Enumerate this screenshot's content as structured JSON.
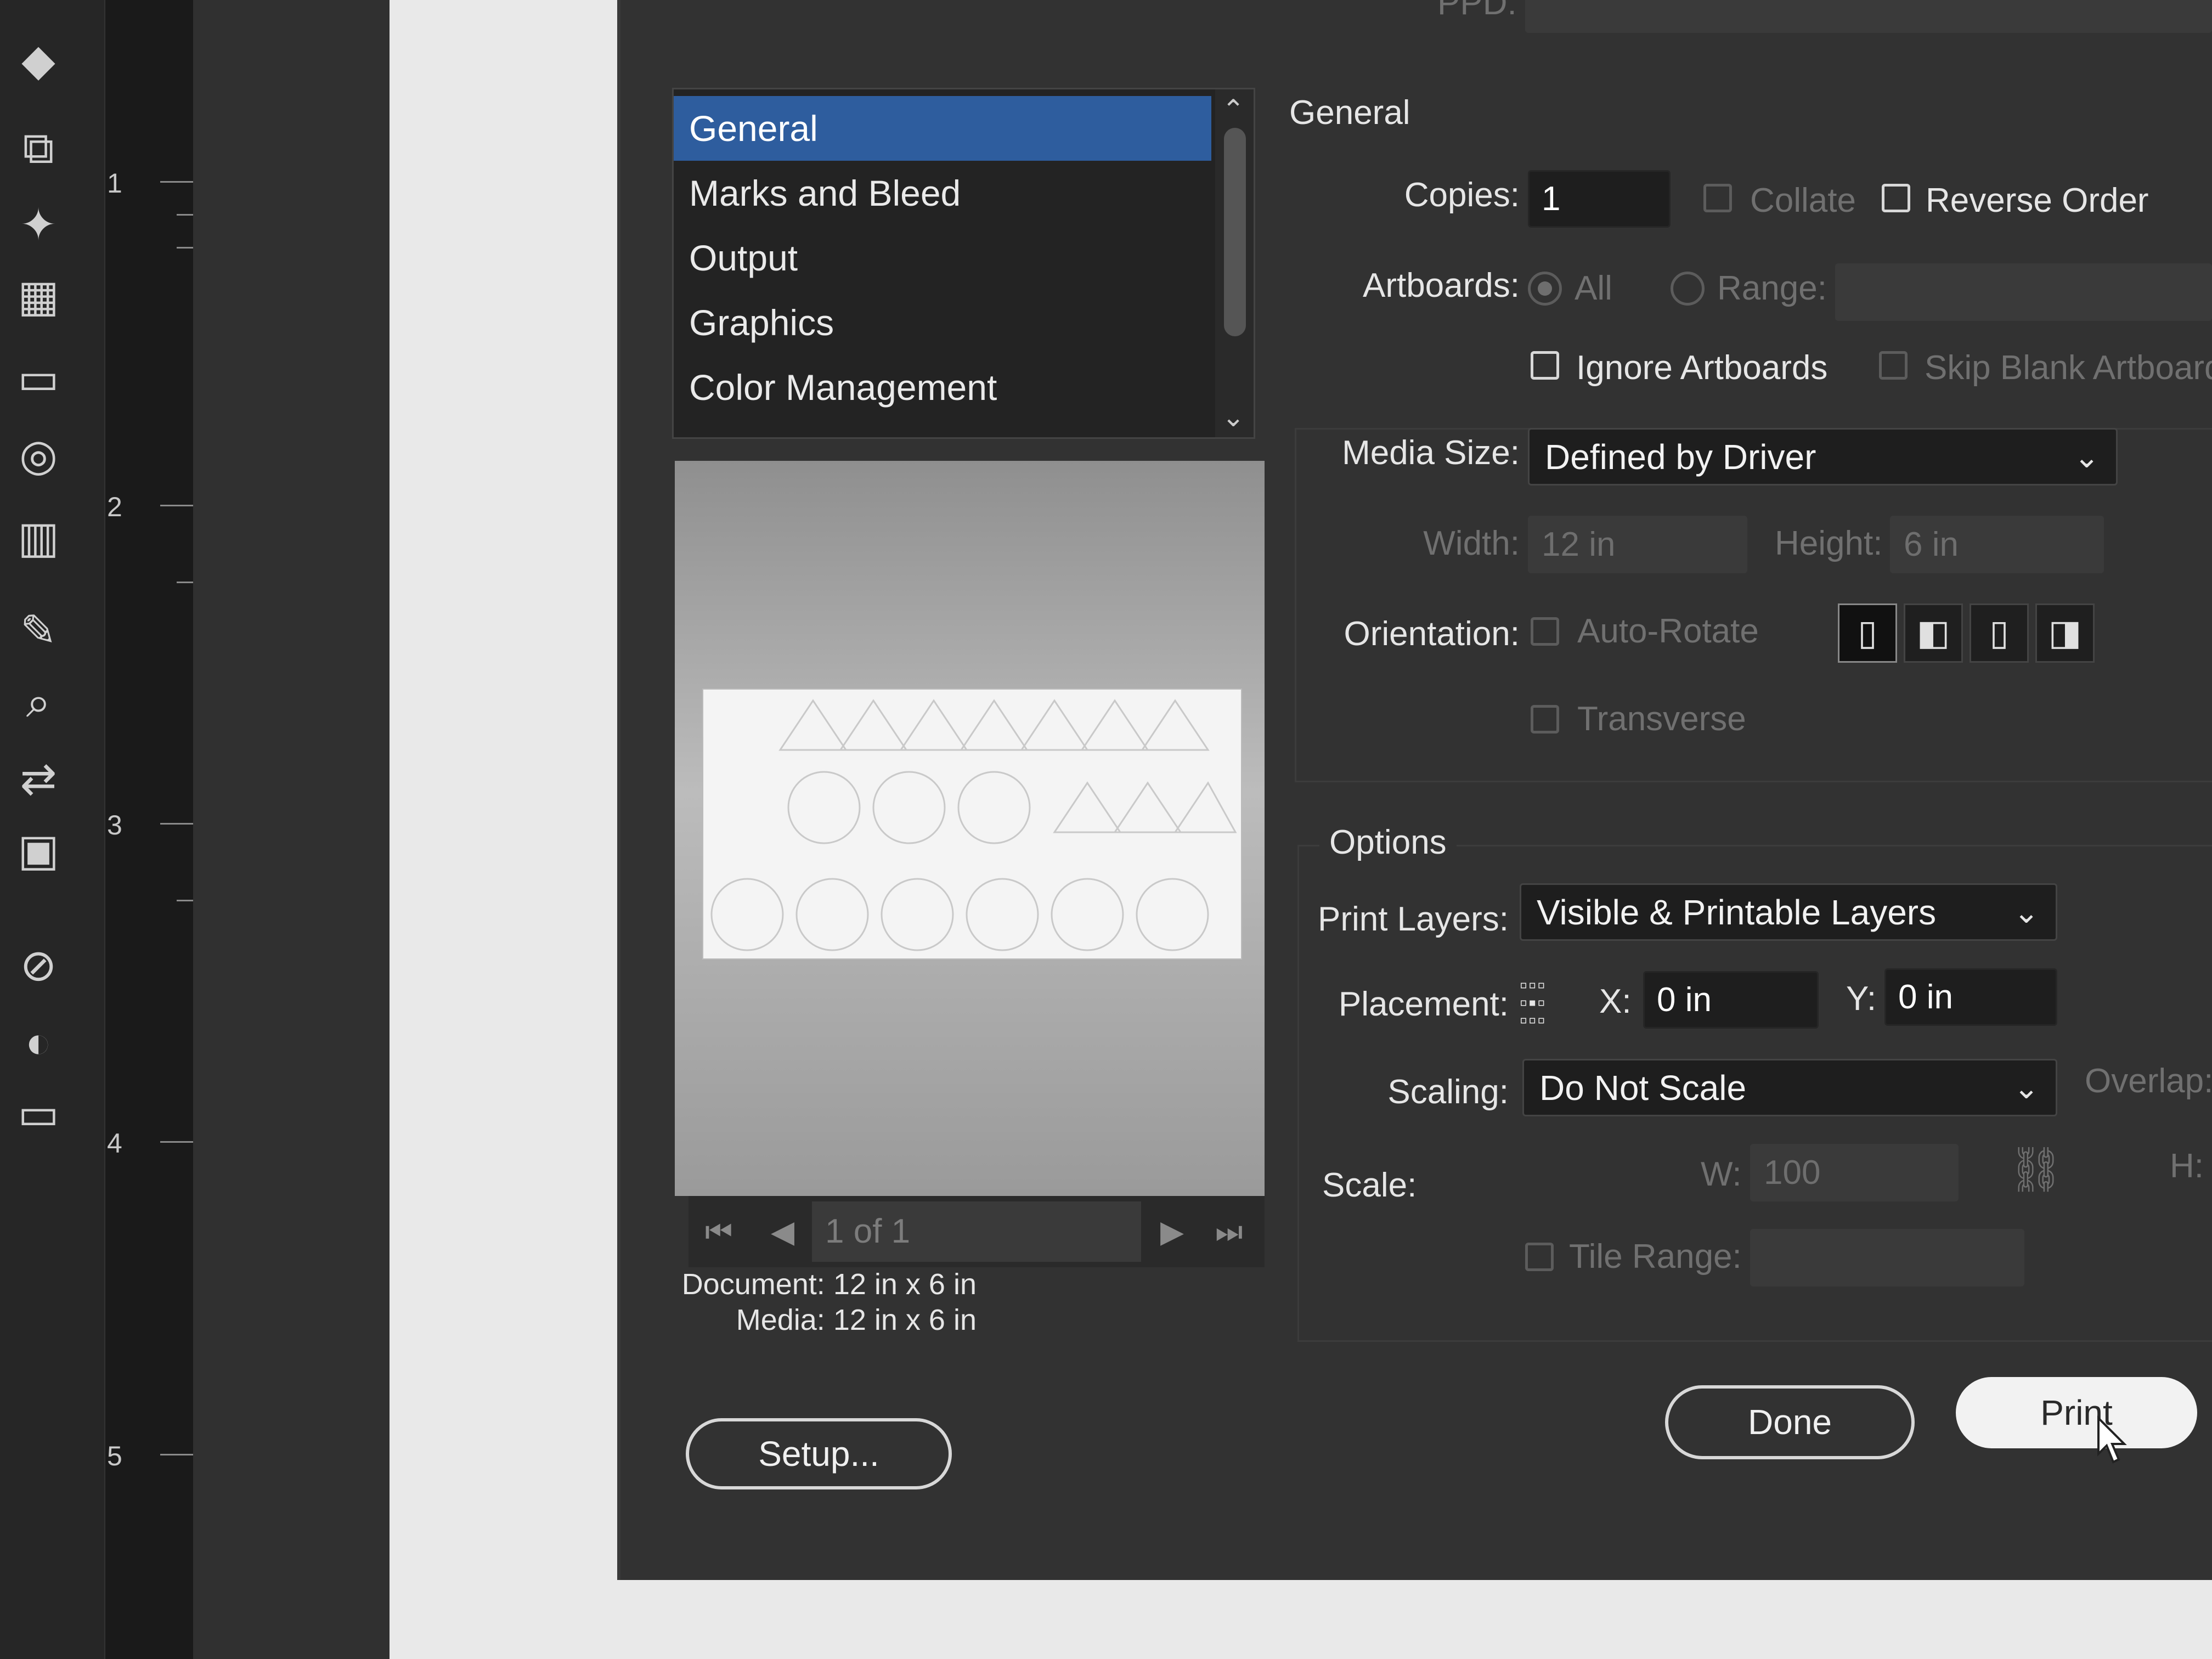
{
  "ruler": {
    "numbers": [
      "1",
      "2",
      "3",
      "4",
      "5"
    ]
  },
  "dialog": {
    "top_label": "PPD:",
    "categories": [
      "General",
      "Marks and Bleed",
      "Output",
      "Graphics",
      "Color Management"
    ],
    "selected_category": "General",
    "preview": {
      "page_indicator": "1 of 1",
      "document_label": "Document:",
      "document_value": "12 in x 6 in",
      "media_label": "Media:",
      "media_value": "12 in x 6 in"
    },
    "general": {
      "section_title": "General",
      "copies_label": "Copies:",
      "copies_value": "1",
      "collate_label": "Collate",
      "reverse_order_label": "Reverse Order",
      "artboards_label": "Artboards:",
      "all_label": "All",
      "range_label": "Range:",
      "ignore_artboards_label": "Ignore Artboards",
      "skip_blank_label": "Skip Blank Artboards",
      "media_size_label": "Media Size:",
      "media_size_value": "Defined by Driver",
      "width_label": "Width:",
      "width_value": "12 in",
      "height_label": "Height:",
      "height_value": "6 in",
      "orientation_label": "Orientation:",
      "auto_rotate_label": "Auto-Rotate",
      "transverse_label": "Transverse"
    },
    "options": {
      "section_title": "Options",
      "print_layers_label": "Print Layers:",
      "print_layers_value": "Visible & Printable Layers",
      "placement_label": "Placement:",
      "x_label": "X:",
      "x_value": "0 in",
      "y_label": "Y:",
      "y_value": "0 in",
      "scaling_label": "Scaling:",
      "scaling_value": "Do Not Scale",
      "overlap_label": "Overlap:",
      "scale_label": "Scale:",
      "w_label": "W:",
      "w_value": "100",
      "h_label": "H:",
      "tile_range_label": "Tile Range:"
    },
    "buttons": {
      "setup": "Setup...",
      "done": "Done",
      "print": "Print"
    }
  },
  "colors": {
    "selection": "#2e5d9e",
    "dialog_bg": "#323232",
    "field_bg": "#1e1e1e"
  }
}
